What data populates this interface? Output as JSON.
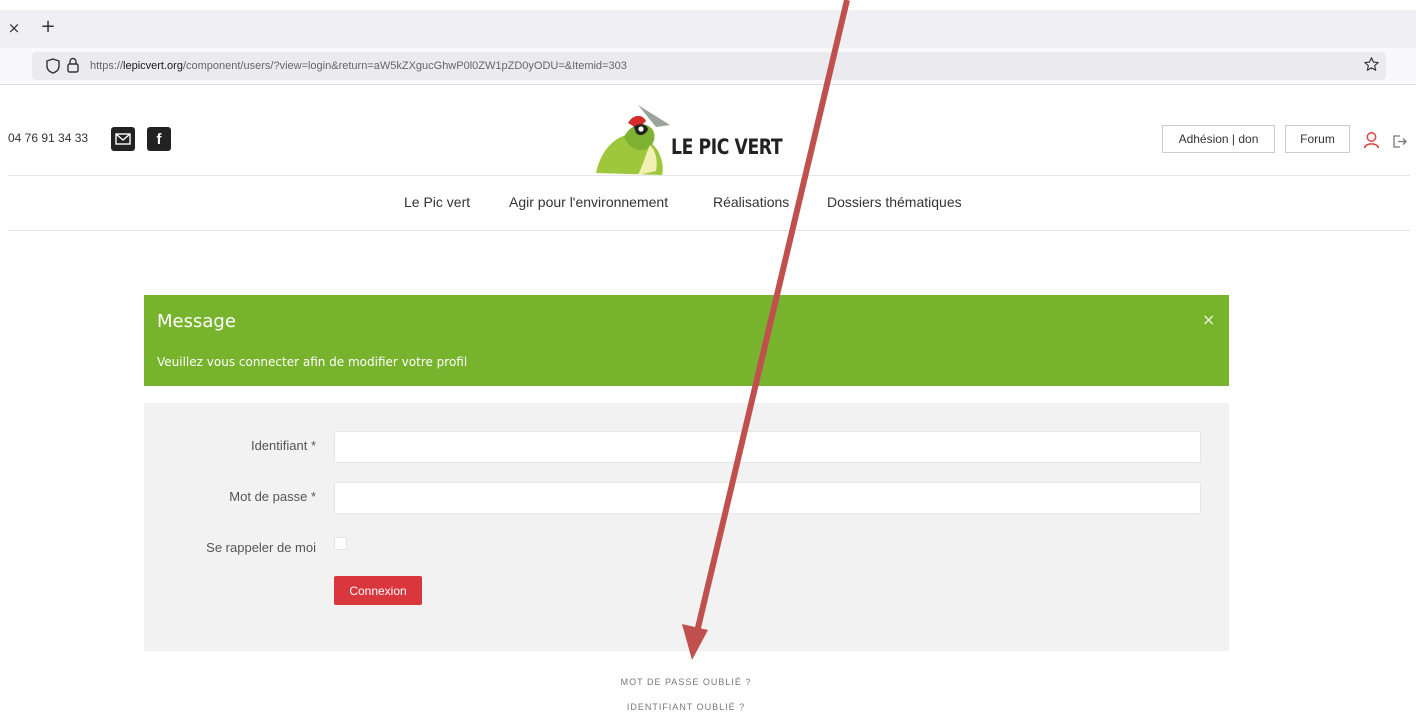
{
  "browser": {
    "tab_close": "×",
    "tab_new": "+",
    "url_scheme": "https://",
    "url_domain": "lepicvert.org",
    "url_path": "/component/users/?view=login&return=aW5kZXgucGhwP0l0ZW1pZD0yODU=&Itemid=303"
  },
  "header": {
    "phone": "04 76 91 34 33",
    "facebook_glyph": "f",
    "logo_text": "LE PIC VERT",
    "membership_button": "Adhésion | don",
    "forum_button": "Forum",
    "icons": [
      "shield-icon",
      "lock-icon",
      "star-icon",
      "mail-icon",
      "facebook-icon",
      "user-icon",
      "logout-icon"
    ]
  },
  "nav": {
    "items": [
      {
        "label": "Le Pic vert"
      },
      {
        "label": "Agir pour l'environnement"
      },
      {
        "label": "Réalisations"
      },
      {
        "label": "Dossiers thématiques"
      }
    ]
  },
  "message": {
    "title": "Message",
    "text": "Veuillez vous connecter afin de modifier votre profil",
    "close": "×",
    "color": "#77b32c"
  },
  "login": {
    "username_label": "Identifiant *",
    "username_value": "",
    "password_label": "Mot de passe *",
    "password_value": "",
    "remember_label": "Se rappeler de moi",
    "remember_checked": false,
    "submit_label": "Connexion",
    "submit_color": "#d9363e"
  },
  "links": {
    "forgot_password": "MOT DE PASSE OUBLIÉ ?",
    "forgot_username": "IDENTIFIANT OUBLIÉ ?"
  },
  "annotation": {
    "color": "#c0504d"
  }
}
